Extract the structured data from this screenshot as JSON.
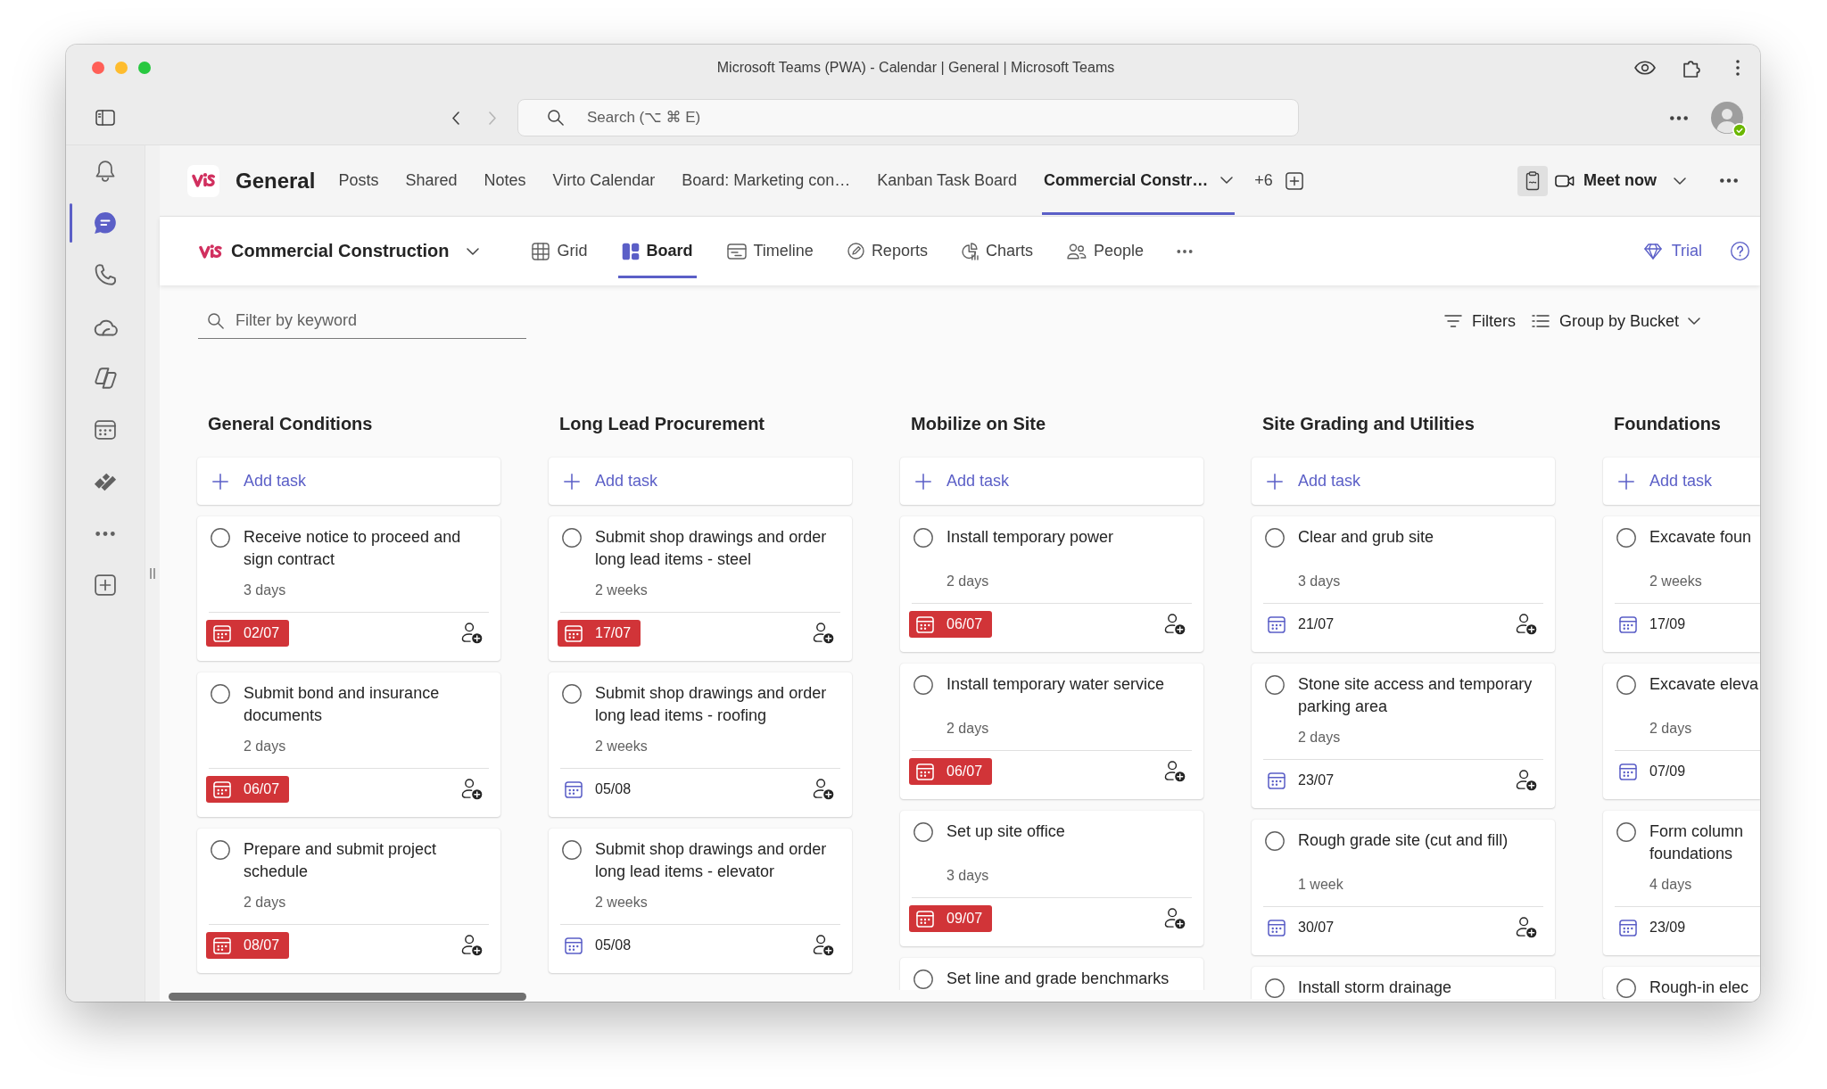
{
  "window": {
    "title": "Microsoft Teams (PWA) - Calendar | General | Microsoft Teams"
  },
  "toolbar": {
    "search": {
      "placeholder": "Search (⌥ ⌘ E)"
    },
    "avatar": {
      "online": true
    }
  },
  "rail": {
    "items": [
      {
        "kind": "bell",
        "selected": false
      },
      {
        "kind": "chat",
        "selected": true
      },
      {
        "kind": "phone",
        "selected": false
      },
      {
        "kind": "cloud",
        "selected": false
      },
      {
        "kind": "shapes",
        "selected": false
      },
      {
        "kind": "calendar",
        "selected": false
      },
      {
        "kind": "blocks",
        "selected": false
      },
      {
        "kind": "more",
        "selected": false
      },
      {
        "kind": "add",
        "selected": false
      }
    ]
  },
  "channel": {
    "name": "General",
    "tabs": [
      {
        "label": "Posts",
        "selected": false
      },
      {
        "label": "Shared",
        "selected": false
      },
      {
        "label": "Notes",
        "selected": false
      },
      {
        "label": "Virto Calendar",
        "selected": false
      },
      {
        "label": "Board: Marketing con…",
        "selected": false
      },
      {
        "label": "Kanban Task Board",
        "selected": false
      },
      {
        "label": "Commercial Constr…",
        "selected": true
      }
    ],
    "more_tabs": "+6",
    "meet_button": "Meet now"
  },
  "app": {
    "title": "Commercial Construction",
    "tabs": [
      {
        "kind": "grid",
        "label": "Grid",
        "selected": false
      },
      {
        "kind": "board",
        "label": "Board",
        "selected": true
      },
      {
        "kind": "timeline",
        "label": "Timeline",
        "selected": false
      },
      {
        "kind": "reports",
        "label": "Reports",
        "selected": false
      },
      {
        "kind": "charts",
        "label": "Charts",
        "selected": false
      },
      {
        "kind": "people",
        "label": "People",
        "selected": false
      }
    ],
    "trial_button": "Trial"
  },
  "filter_bar": {
    "search": {
      "placeholder": "Filter by keyword"
    },
    "filters_button": "Filters",
    "group_button": "Group by Bucket"
  },
  "board": {
    "columns": [
      {
        "title": "General Conditions",
        "cut_off": false,
        "add_task": "Add task",
        "tasks": [
          {
            "title": "Receive notice to proceed and sign contract",
            "completed": false,
            "duration": "3 days",
            "due": "02/07",
            "late": true
          },
          {
            "title": "Submit bond and insurance documents",
            "completed": false,
            "duration": "2 days",
            "due": "06/07",
            "late": true
          },
          {
            "title": "Prepare and submit project schedule",
            "completed": false,
            "duration": "2 days",
            "due": "08/07",
            "late": true
          }
        ]
      },
      {
        "title": "Long Lead Procurement",
        "cut_off": false,
        "add_task": "Add task",
        "tasks": [
          {
            "title": "Submit shop drawings and order long lead items - steel",
            "completed": false,
            "duration": "2 weeks",
            "due": "17/07",
            "late": true
          },
          {
            "title": "Submit shop drawings and order long lead items - roofing",
            "completed": false,
            "duration": "2 weeks",
            "due": "05/08",
            "late": false
          },
          {
            "title": "Submit shop drawings and order long lead items - elevator",
            "completed": false,
            "duration": "2 weeks",
            "due": "05/08",
            "late": false
          }
        ]
      },
      {
        "title": "Mobilize on Site",
        "cut_off": false,
        "add_task": "Add task",
        "tasks": [
          {
            "title": "Install temporary power",
            "completed": false,
            "duration": "2 days",
            "due": "06/07",
            "late": true
          },
          {
            "title": "Install temporary water service",
            "completed": false,
            "duration": "2 days",
            "due": "06/07",
            "late": true
          },
          {
            "title": "Set up site office",
            "completed": false,
            "duration": "3 days",
            "due": "09/07",
            "late": true
          },
          {
            "title": "Set line and grade benchmarks",
            "completed": false
          }
        ]
      },
      {
        "title": "Site Grading and Utilities",
        "cut_off": false,
        "add_task": "Add task",
        "tasks": [
          {
            "title": "Clear and grub site",
            "completed": false,
            "duration": "3 days",
            "due": "21/07",
            "late": false
          },
          {
            "title": "Stone site access and temporary parking area",
            "completed": false,
            "duration": "2 days",
            "due": "23/07",
            "late": false
          },
          {
            "title": "Rough grade site (cut and fill)",
            "completed": false,
            "duration": "1 week",
            "due": "30/07",
            "late": false
          },
          {
            "title": "Install storm drainage",
            "completed": false
          }
        ]
      },
      {
        "title": "Foundations",
        "cut_off": true,
        "add_task": "Add task",
        "tasks": [
          {
            "title": "Excavate foun",
            "completed": false,
            "duration": "2 weeks",
            "due": "17/09",
            "late": false
          },
          {
            "title": "Excavate eleva",
            "completed": false,
            "duration": "2 days",
            "due": "07/09",
            "late": false
          },
          {
            "title": "Form column foundations",
            "completed": false,
            "duration": "4 days",
            "due": "23/09",
            "late": false
          },
          {
            "title": "Rough-in elec",
            "completed": false
          }
        ]
      }
    ]
  }
}
